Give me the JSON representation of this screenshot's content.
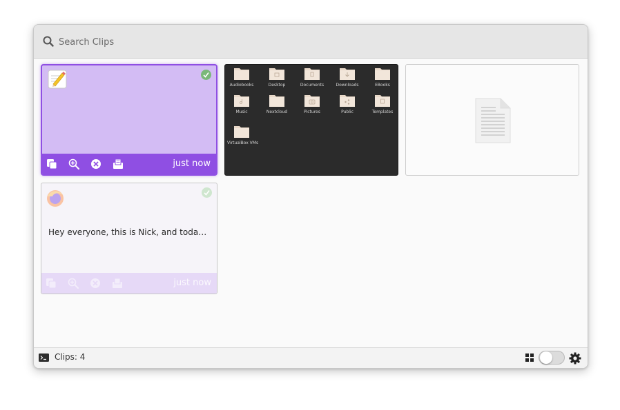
{
  "search": {
    "placeholder": "Search Clips",
    "value": ""
  },
  "clips": [
    {
      "type": "text",
      "app_icon": "text-editor-icon",
      "time": "just now",
      "selected": true
    },
    {
      "type": "image",
      "folders": [
        "Audiobooks",
        "Desktop",
        "Documents",
        "Downloads",
        "EBooks",
        "Music",
        "Nextcloud",
        "Pictures",
        "Public",
        "Templates",
        "VirtualBox VMs"
      ]
    },
    {
      "type": "file",
      "icon": "document-icon"
    },
    {
      "type": "text",
      "app_icon": "firefox-icon",
      "text": "Hey everyone, this is Nick, and today, w…",
      "time": "just now"
    }
  ],
  "status": {
    "clips_count": "Clips: 4"
  },
  "colors": {
    "accent": "#8f4fe3",
    "selected_bg": "#d3bcf4"
  }
}
